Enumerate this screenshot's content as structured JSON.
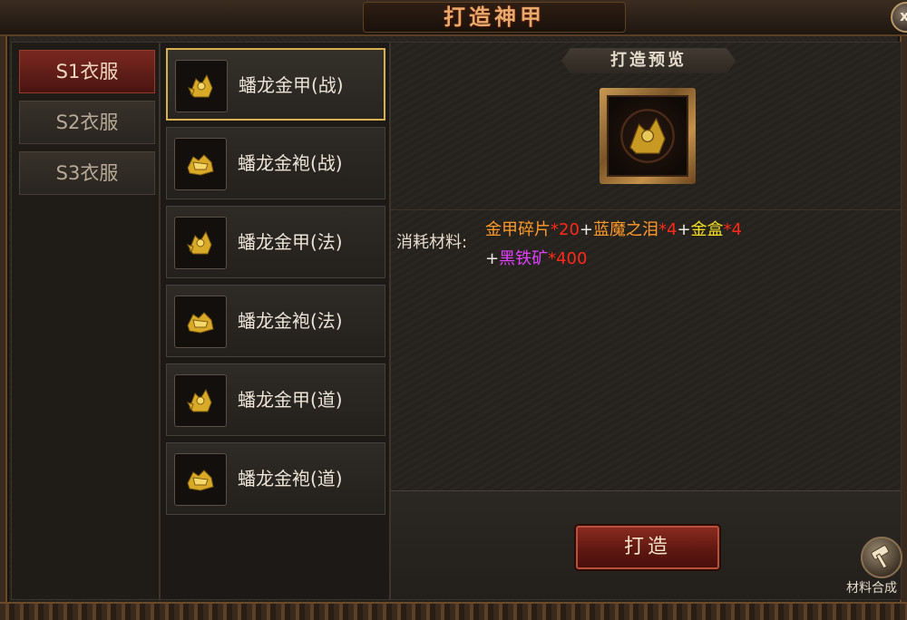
{
  "window": {
    "title": "打造神甲",
    "close_label": "x"
  },
  "categories": [
    {
      "label": "S1衣服",
      "active": true
    },
    {
      "label": "S2衣服",
      "active": false
    },
    {
      "label": "S3衣服",
      "active": false
    }
  ],
  "items": [
    {
      "label": "蟠龙金甲(战)",
      "icon": "golden-armor-icon",
      "selected": true
    },
    {
      "label": "蟠龙金袍(战)",
      "icon": "golden-robe-icon",
      "selected": false
    },
    {
      "label": "蟠龙金甲(法)",
      "icon": "golden-armor-icon",
      "selected": false
    },
    {
      "label": "蟠龙金袍(法)",
      "icon": "golden-robe-icon",
      "selected": false
    },
    {
      "label": "蟠龙金甲(道)",
      "icon": "golden-armor-icon",
      "selected": false
    },
    {
      "label": "蟠龙金袍(道)",
      "icon": "golden-robe-icon",
      "selected": false
    }
  ],
  "preview": {
    "heading": "打造预览",
    "icon": "golden-armor-icon"
  },
  "materials": {
    "label": "消耗材料:",
    "line1": [
      {
        "text": "金甲碎片",
        "color": "#ff9a2a"
      },
      {
        "text": "*20",
        "color": "#ff2a1a"
      },
      {
        "text": "+",
        "color": "#f0ece4"
      },
      {
        "text": "蓝魔之泪",
        "color": "#ff9a2a"
      },
      {
        "text": "*4",
        "color": "#ff2a1a"
      },
      {
        "text": "+",
        "color": "#f0ece4"
      },
      {
        "text": "金盒",
        "color": "#f6e020"
      },
      {
        "text": "*4",
        "color": "#ff2a1a"
      }
    ],
    "line2": [
      {
        "text": "+",
        "color": "#f0ece4"
      },
      {
        "text": "黑铁矿",
        "color": "#e040ff"
      },
      {
        "text": "*400",
        "color": "#ff2a1a"
      }
    ]
  },
  "actions": {
    "forge_label": "打造",
    "synthesize_label": "材料合成",
    "synthesize_icon": "hammer-icon"
  }
}
